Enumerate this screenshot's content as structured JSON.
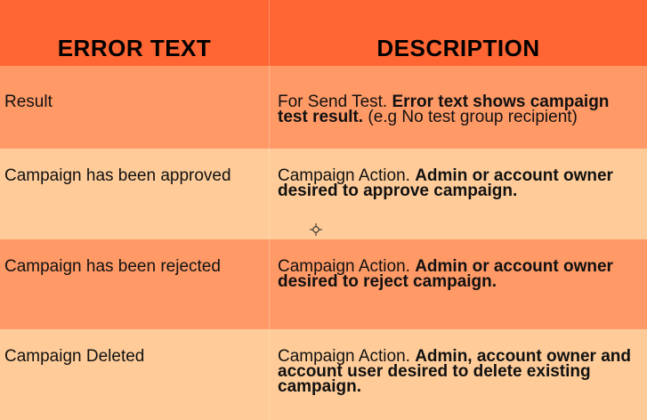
{
  "colors": {
    "header_bg": "#ff6633",
    "row_dark_bg": "#ff9966",
    "row_light_bg": "#ffcc99"
  },
  "table": {
    "headers": [
      "ERROR TEXT",
      "DESCRIPTION"
    ],
    "rows": [
      {
        "error_text": "Result",
        "desc_plain": "For Send Test. ",
        "desc_bold": "Error text shows campaign test result.",
        "desc_tail": " (e.g No test group recipient)"
      },
      {
        "error_text": "Campaign has been approved",
        "desc_plain": "Campaign Action. ",
        "desc_bold": "Admin or account owner desired to approve campaign.",
        "desc_tail": ""
      },
      {
        "error_text": "Campaign has been rejected",
        "desc_plain": "Campaign Action. ",
        "desc_bold": "Admin or account owner desired to reject campaign.",
        "desc_tail": ""
      },
      {
        "error_text": "Campaign Deleted",
        "desc_plain": "Campaign Action. ",
        "desc_bold": "Admin, account owner and account user desired to delete existing campaign.",
        "desc_tail": ""
      }
    ]
  },
  "cursor": {
    "icon": "crosshair-cursor-icon"
  }
}
